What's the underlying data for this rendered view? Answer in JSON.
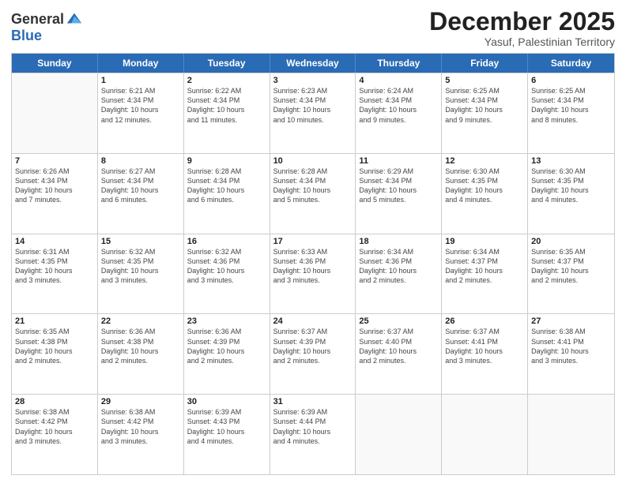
{
  "logo": {
    "general": "General",
    "blue": "Blue"
  },
  "title": "December 2025",
  "subtitle": "Yasuf, Palestinian Territory",
  "headers": [
    "Sunday",
    "Monday",
    "Tuesday",
    "Wednesday",
    "Thursday",
    "Friday",
    "Saturday"
  ],
  "rows": [
    [
      {
        "day": "",
        "info": ""
      },
      {
        "day": "1",
        "info": "Sunrise: 6:21 AM\nSunset: 4:34 PM\nDaylight: 10 hours\nand 12 minutes."
      },
      {
        "day": "2",
        "info": "Sunrise: 6:22 AM\nSunset: 4:34 PM\nDaylight: 10 hours\nand 11 minutes."
      },
      {
        "day": "3",
        "info": "Sunrise: 6:23 AM\nSunset: 4:34 PM\nDaylight: 10 hours\nand 10 minutes."
      },
      {
        "day": "4",
        "info": "Sunrise: 6:24 AM\nSunset: 4:34 PM\nDaylight: 10 hours\nand 9 minutes."
      },
      {
        "day": "5",
        "info": "Sunrise: 6:25 AM\nSunset: 4:34 PM\nDaylight: 10 hours\nand 9 minutes."
      },
      {
        "day": "6",
        "info": "Sunrise: 6:25 AM\nSunset: 4:34 PM\nDaylight: 10 hours\nand 8 minutes."
      }
    ],
    [
      {
        "day": "7",
        "info": "Sunrise: 6:26 AM\nSunset: 4:34 PM\nDaylight: 10 hours\nand 7 minutes."
      },
      {
        "day": "8",
        "info": "Sunrise: 6:27 AM\nSunset: 4:34 PM\nDaylight: 10 hours\nand 6 minutes."
      },
      {
        "day": "9",
        "info": "Sunrise: 6:28 AM\nSunset: 4:34 PM\nDaylight: 10 hours\nand 6 minutes."
      },
      {
        "day": "10",
        "info": "Sunrise: 6:28 AM\nSunset: 4:34 PM\nDaylight: 10 hours\nand 5 minutes."
      },
      {
        "day": "11",
        "info": "Sunrise: 6:29 AM\nSunset: 4:34 PM\nDaylight: 10 hours\nand 5 minutes."
      },
      {
        "day": "12",
        "info": "Sunrise: 6:30 AM\nSunset: 4:35 PM\nDaylight: 10 hours\nand 4 minutes."
      },
      {
        "day": "13",
        "info": "Sunrise: 6:30 AM\nSunset: 4:35 PM\nDaylight: 10 hours\nand 4 minutes."
      }
    ],
    [
      {
        "day": "14",
        "info": "Sunrise: 6:31 AM\nSunset: 4:35 PM\nDaylight: 10 hours\nand 3 minutes."
      },
      {
        "day": "15",
        "info": "Sunrise: 6:32 AM\nSunset: 4:35 PM\nDaylight: 10 hours\nand 3 minutes."
      },
      {
        "day": "16",
        "info": "Sunrise: 6:32 AM\nSunset: 4:36 PM\nDaylight: 10 hours\nand 3 minutes."
      },
      {
        "day": "17",
        "info": "Sunrise: 6:33 AM\nSunset: 4:36 PM\nDaylight: 10 hours\nand 3 minutes."
      },
      {
        "day": "18",
        "info": "Sunrise: 6:34 AM\nSunset: 4:36 PM\nDaylight: 10 hours\nand 2 minutes."
      },
      {
        "day": "19",
        "info": "Sunrise: 6:34 AM\nSunset: 4:37 PM\nDaylight: 10 hours\nand 2 minutes."
      },
      {
        "day": "20",
        "info": "Sunrise: 6:35 AM\nSunset: 4:37 PM\nDaylight: 10 hours\nand 2 minutes."
      }
    ],
    [
      {
        "day": "21",
        "info": "Sunrise: 6:35 AM\nSunset: 4:38 PM\nDaylight: 10 hours\nand 2 minutes."
      },
      {
        "day": "22",
        "info": "Sunrise: 6:36 AM\nSunset: 4:38 PM\nDaylight: 10 hours\nand 2 minutes."
      },
      {
        "day": "23",
        "info": "Sunrise: 6:36 AM\nSunset: 4:39 PM\nDaylight: 10 hours\nand 2 minutes."
      },
      {
        "day": "24",
        "info": "Sunrise: 6:37 AM\nSunset: 4:39 PM\nDaylight: 10 hours\nand 2 minutes."
      },
      {
        "day": "25",
        "info": "Sunrise: 6:37 AM\nSunset: 4:40 PM\nDaylight: 10 hours\nand 2 minutes."
      },
      {
        "day": "26",
        "info": "Sunrise: 6:37 AM\nSunset: 4:41 PM\nDaylight: 10 hours\nand 3 minutes."
      },
      {
        "day": "27",
        "info": "Sunrise: 6:38 AM\nSunset: 4:41 PM\nDaylight: 10 hours\nand 3 minutes."
      }
    ],
    [
      {
        "day": "28",
        "info": "Sunrise: 6:38 AM\nSunset: 4:42 PM\nDaylight: 10 hours\nand 3 minutes."
      },
      {
        "day": "29",
        "info": "Sunrise: 6:38 AM\nSunset: 4:42 PM\nDaylight: 10 hours\nand 3 minutes."
      },
      {
        "day": "30",
        "info": "Sunrise: 6:39 AM\nSunset: 4:43 PM\nDaylight: 10 hours\nand 4 minutes."
      },
      {
        "day": "31",
        "info": "Sunrise: 6:39 AM\nSunset: 4:44 PM\nDaylight: 10 hours\nand 4 minutes."
      },
      {
        "day": "",
        "info": ""
      },
      {
        "day": "",
        "info": ""
      },
      {
        "day": "",
        "info": ""
      }
    ]
  ]
}
